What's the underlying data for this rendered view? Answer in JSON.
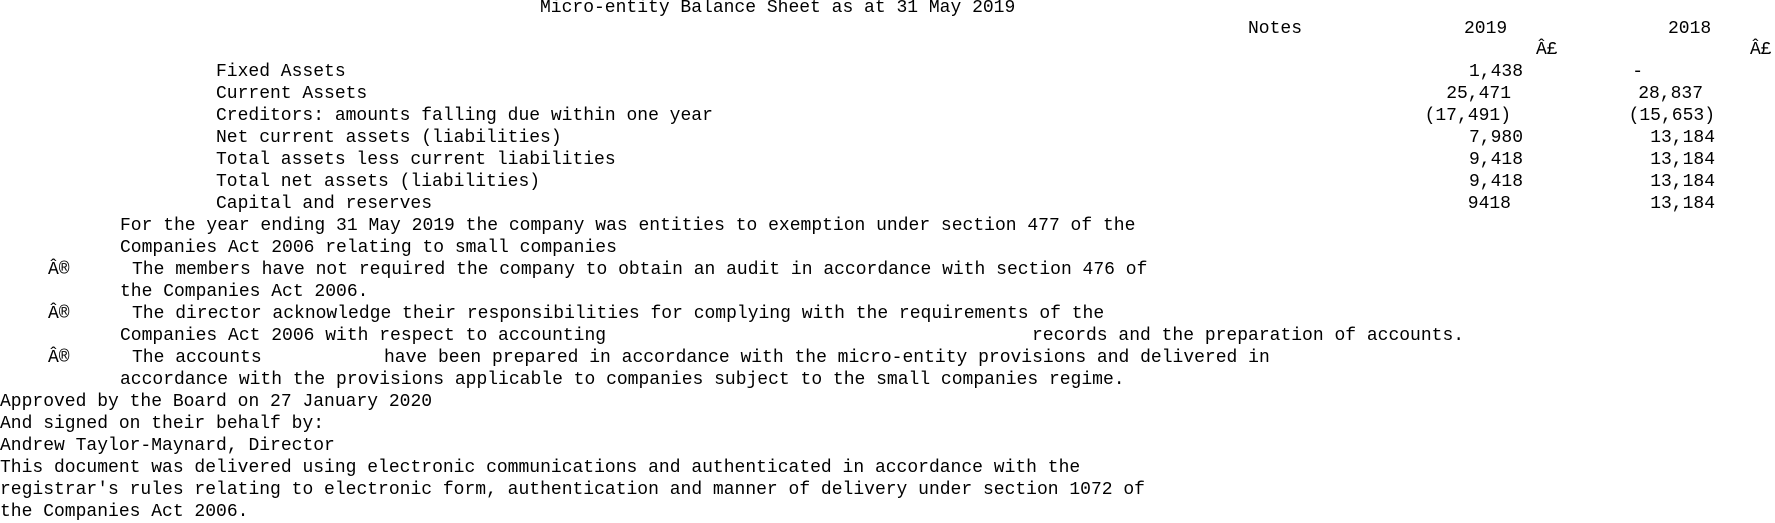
{
  "title": "Micro-entity Balance Sheet as at 31 May 2019",
  "columns": {
    "notes": "Notes",
    "year_current": "2019",
    "year_prior": "2018",
    "currency_current": "Â£",
    "currency_prior": "Â£"
  },
  "rows": [
    {
      "label": "Fixed Assets",
      "current": "1,438",
      "prior": "-"
    },
    {
      "label": "Current Assets",
      "current": "25,471",
      "prior": "28,837"
    },
    {
      "label": "Creditors: amounts falling due within one year",
      "current": "(17,491)",
      "prior": "(15,653)"
    },
    {
      "label": "Net current assets (liabilities)",
      "current": "7,980",
      "prior": "13,184"
    },
    {
      "label": "Total assets less current liabilities",
      "current": "9,418",
      "prior": "13,184"
    },
    {
      "label": "Total net assets (liabilities)",
      "current": "9,418",
      "prior": "13,184"
    },
    {
      "label": "Capital and reserves",
      "current": "9418",
      "prior": "13,184"
    }
  ],
  "statements": {
    "exemption_line1": "For the year ending 31 May 2019 the company was entities to exemption under section 477 of the",
    "exemption_line2": "Companies Act 2006 relating to small companies",
    "bullet_symbol": "Â®",
    "bullet1_line1": "The members have not required the company to obtain an audit in accordance with section 476 of",
    "bullet1_line2": "the Companies Act 2006.",
    "bullet2_line1": "The director acknowledge their responsibilities for complying with the requirements of the",
    "bullet2_line2a": "Companies Act 2006 with respect to accounting",
    "bullet2_line2b": "records and the preparation of accounts.",
    "bullet3_line1a": "The accounts",
    "bullet3_line1b": "have been prepared in accordance with the micro-entity provisions and delivered in",
    "bullet3_line2": "accordance with the provisions applicable to companies subject to the small companies regime."
  },
  "approval": {
    "approved": "Approved by the Board on 27 January 2020",
    "signed": "And signed on their behalf by:",
    "signatory": "Andrew Taylor-Maynard, Director"
  },
  "footer": {
    "line1": "This document was delivered using electronic communications and authenticated in accordance with the",
    "line2": "registrar's rules relating to electronic form, authentication and manner of delivery under section 1072 of",
    "line3": "the Companies Act 2006."
  }
}
